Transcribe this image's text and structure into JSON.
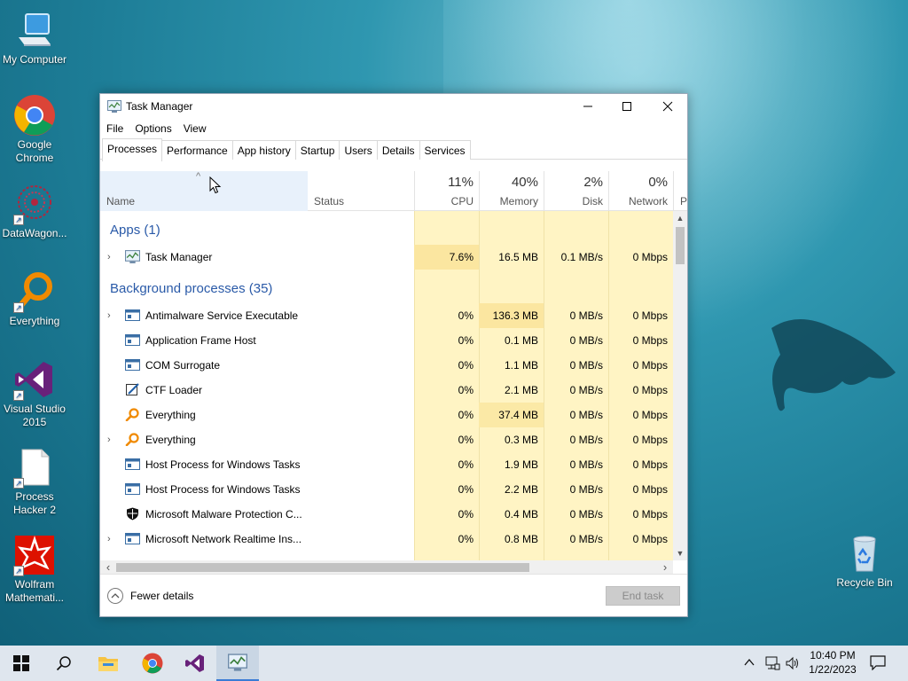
{
  "desktop": {
    "icons": [
      {
        "label": "My Computer",
        "name": "my-computer-icon"
      },
      {
        "label": "Google Chrome",
        "name": "google-chrome-icon"
      },
      {
        "label": "DataWagon...",
        "name": "datawagon-icon"
      },
      {
        "label": "Everything",
        "name": "everything-icon"
      },
      {
        "label": "Visual Studio 2015",
        "name": "visual-studio-icon"
      },
      {
        "label": "Process Hacker 2",
        "name": "process-hacker-icon"
      },
      {
        "label": "Wolfram Mathemati...",
        "name": "wolfram-mathematica-icon"
      },
      {
        "label": "Recycle Bin",
        "name": "recycle-bin-icon"
      }
    ]
  },
  "window": {
    "title": "Task Manager",
    "menu": [
      "File",
      "Options",
      "View"
    ],
    "tabs": [
      "Processes",
      "Performance",
      "App history",
      "Startup",
      "Users",
      "Details",
      "Services"
    ],
    "active_tab": "Processes",
    "columns": {
      "name": "Name",
      "status": "Status",
      "cpu": {
        "pct": "11%",
        "label": "CPU"
      },
      "memory": {
        "pct": "40%",
        "label": "Memory"
      },
      "disk": {
        "pct": "2%",
        "label": "Disk"
      },
      "network": {
        "pct": "0%",
        "label": "Network"
      },
      "power_partial": "P"
    },
    "groups": {
      "apps": "Apps (1)",
      "background": "Background processes (35)"
    },
    "processes": [
      {
        "name": "Task Manager",
        "cpu": "7.6%",
        "memory": "16.5 MB",
        "disk": "0.1 MB/s",
        "network": "0 Mbps",
        "expandable": true,
        "icon": "task-manager-icon"
      },
      {
        "name": "Antimalware Service Executable",
        "cpu": "0%",
        "memory": "136.3 MB",
        "disk": "0 MB/s",
        "network": "0 Mbps",
        "expandable": true,
        "icon": "service-window-icon"
      },
      {
        "name": "Application Frame Host",
        "cpu": "0%",
        "memory": "0.1 MB",
        "disk": "0 MB/s",
        "network": "0 Mbps",
        "expandable": false,
        "icon": "service-window-icon"
      },
      {
        "name": "COM Surrogate",
        "cpu": "0%",
        "memory": "1.1 MB",
        "disk": "0 MB/s",
        "network": "0 Mbps",
        "expandable": false,
        "icon": "service-window-icon"
      },
      {
        "name": "CTF Loader",
        "cpu": "0%",
        "memory": "2.1 MB",
        "disk": "0 MB/s",
        "network": "0 Mbps",
        "expandable": false,
        "icon": "ctf-loader-icon"
      },
      {
        "name": "Everything",
        "cpu": "0%",
        "memory": "37.4 MB",
        "disk": "0 MB/s",
        "network": "0 Mbps",
        "expandable": false,
        "icon": "everything-magnifier-icon"
      },
      {
        "name": "Everything",
        "cpu": "0%",
        "memory": "0.3 MB",
        "disk": "0 MB/s",
        "network": "0 Mbps",
        "expandable": true,
        "icon": "everything-magnifier-icon"
      },
      {
        "name": "Host Process for Windows Tasks",
        "cpu": "0%",
        "memory": "1.9 MB",
        "disk": "0 MB/s",
        "network": "0 Mbps",
        "expandable": false,
        "icon": "service-window-icon"
      },
      {
        "name": "Host Process for Windows Tasks",
        "cpu": "0%",
        "memory": "2.2 MB",
        "disk": "0 MB/s",
        "network": "0 Mbps",
        "expandable": false,
        "icon": "service-window-icon"
      },
      {
        "name": "Microsoft Malware Protection C...",
        "cpu": "0%",
        "memory": "0.4 MB",
        "disk": "0 MB/s",
        "network": "0 Mbps",
        "expandable": false,
        "icon": "shield-icon"
      },
      {
        "name": "Microsoft Network Realtime Ins...",
        "cpu": "0%",
        "memory": "0.8 MB",
        "disk": "0 MB/s",
        "network": "0 Mbps",
        "expandable": true,
        "icon": "service-window-icon"
      }
    ],
    "footer": {
      "fewer_details": "Fewer details",
      "end_task": "End task"
    }
  },
  "taskbar": {
    "time": "10:40 PM",
    "date": "1/22/2023"
  },
  "colors": {
    "heat_light": "#fff4c4",
    "heat_mid": "#fbe9a6",
    "group_text": "#2a5aa8",
    "taskbar": "#dfe6ee"
  }
}
